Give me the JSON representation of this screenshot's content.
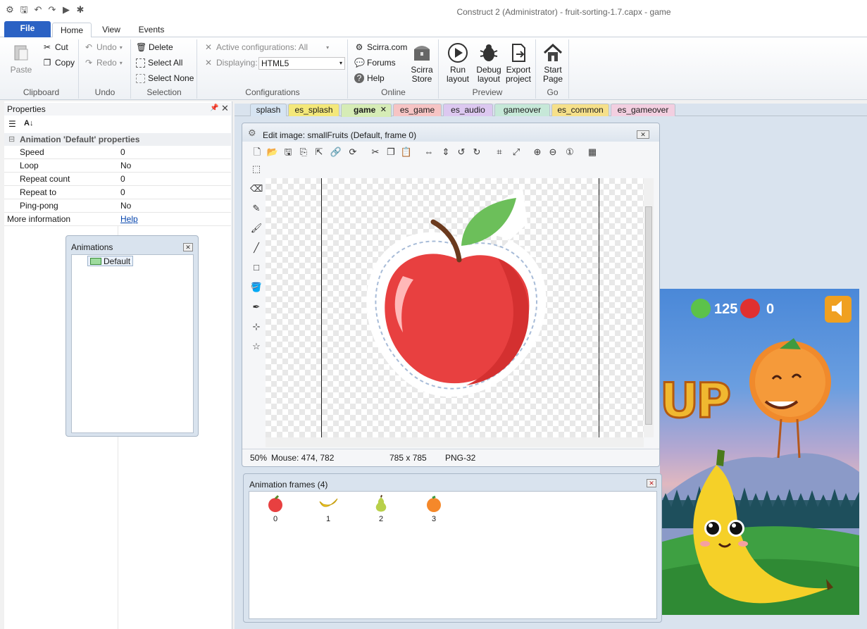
{
  "window": {
    "title": "Construct 2 (Administrator) - fruit-sorting-1.7.capx - game"
  },
  "ribbon_tabs": [
    "File",
    "Home",
    "View",
    "Events"
  ],
  "clipboard": {
    "paste": "Paste",
    "cut": "Cut",
    "copy": "Copy",
    "label": "Clipboard"
  },
  "undo": {
    "undo": "Undo",
    "redo": "Redo",
    "label": "Undo"
  },
  "selection": {
    "delete": "Delete",
    "select_all": "Select All",
    "select_none": "Select None",
    "label": "Selection"
  },
  "configurations": {
    "active": "Active configurations: All",
    "displaying_label": "Displaying:",
    "displaying_value": "HTML5",
    "label": "Configurations"
  },
  "online": {
    "scirra": "Scirra.com",
    "forums": "Forums",
    "help": "Help",
    "store_1": "Scirra",
    "store_2": "Store",
    "label": "Online"
  },
  "preview": {
    "run_1": "Run",
    "run_2": "layout",
    "debug_1": "Debug",
    "debug_2": "layout",
    "export_1": "Export",
    "export_2": "project",
    "label": "Preview"
  },
  "go": {
    "start_1": "Start",
    "start_2": "Page",
    "label": "Go"
  },
  "properties": {
    "title": "Properties",
    "section": "Animation 'Default' properties",
    "rows": [
      {
        "k": "Speed",
        "v": "0"
      },
      {
        "k": "Loop",
        "v": "No"
      },
      {
        "k": "Repeat count",
        "v": "0"
      },
      {
        "k": "Repeat to",
        "v": "0"
      },
      {
        "k": "Ping-pong",
        "v": "No"
      }
    ],
    "more": "More information",
    "help": "Help"
  },
  "animations": {
    "title": "Animations",
    "item": "Default"
  },
  "doc_tabs": [
    {
      "label": "splash",
      "color": "#d6e4f2"
    },
    {
      "label": "es_splash",
      "color": "#f4e87a"
    },
    {
      "label": "game",
      "color": "#d6ecb6"
    },
    {
      "label": "es_game",
      "color": "#f6c4c4"
    },
    {
      "label": "es_audio",
      "color": "#dcc8f0"
    },
    {
      "label": "gameover",
      "color": "#c6e8d8"
    },
    {
      "label": "es_common",
      "color": "#f6e08a"
    },
    {
      "label": "es_gameover",
      "color": "#f2cfe0"
    }
  ],
  "editor": {
    "title": "Edit image: smallFruits (Default, frame 0)",
    "zoom": "50%",
    "mouse": "Mouse: 474, 782",
    "size": "785 x 785",
    "format": "PNG-32"
  },
  "frames": {
    "title": "Animation frames (4)",
    "items": [
      "0",
      "1",
      "2",
      "3"
    ]
  },
  "game": {
    "score": "125",
    "misses": "0",
    "word": "UP"
  }
}
